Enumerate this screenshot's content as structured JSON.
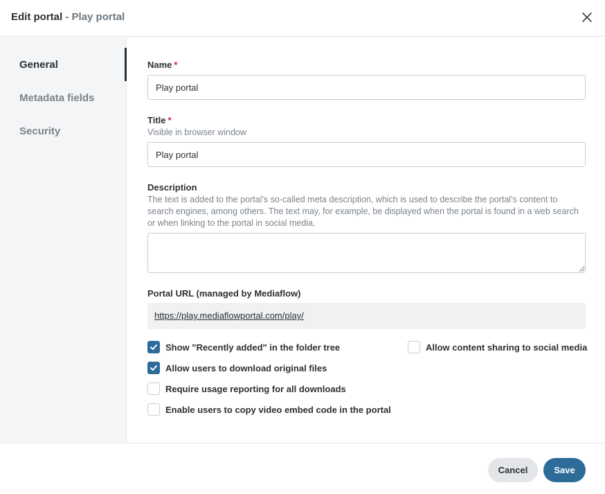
{
  "header": {
    "title": "Edit portal",
    "separator": " - ",
    "subtitle": "Play portal"
  },
  "sidebar": {
    "items": [
      {
        "label": "General",
        "active": true
      },
      {
        "label": "Metadata fields",
        "active": false
      },
      {
        "label": "Security",
        "active": false
      }
    ]
  },
  "form": {
    "name": {
      "label": "Name",
      "required_mark": "*",
      "value": "Play portal"
    },
    "title": {
      "label": "Title",
      "required_mark": "*",
      "hint": "Visible in browser window",
      "value": "Play portal"
    },
    "description": {
      "label": "Description",
      "hint": "The text is added to the portal’s so-called meta description, which is used to describe the portal’s content to search engines, among others. The text may, for example, be displayed when the portal is found in a web search or when linking to the portal in social media.",
      "value": ""
    },
    "portal_url": {
      "label": "Portal URL (managed by Mediaflow)",
      "value": "https://play.mediaflowportal.com/play/"
    },
    "options": [
      {
        "label": "Show \"Recently added\" in the folder tree",
        "checked": true
      },
      {
        "label": "Allow users to download original files",
        "checked": true
      },
      {
        "label": "Require usage reporting for all downloads",
        "checked": false
      },
      {
        "label": "Enable users to copy video embed code in the portal",
        "checked": false
      },
      {
        "label": "Allow content sharing to social media",
        "checked": false
      }
    ]
  },
  "footer": {
    "cancel_label": "Cancel",
    "save_label": "Save"
  },
  "colors": {
    "accent": "#2d6b99",
    "required": "#d0243c",
    "sidebar_bg": "#f4f5f7"
  }
}
